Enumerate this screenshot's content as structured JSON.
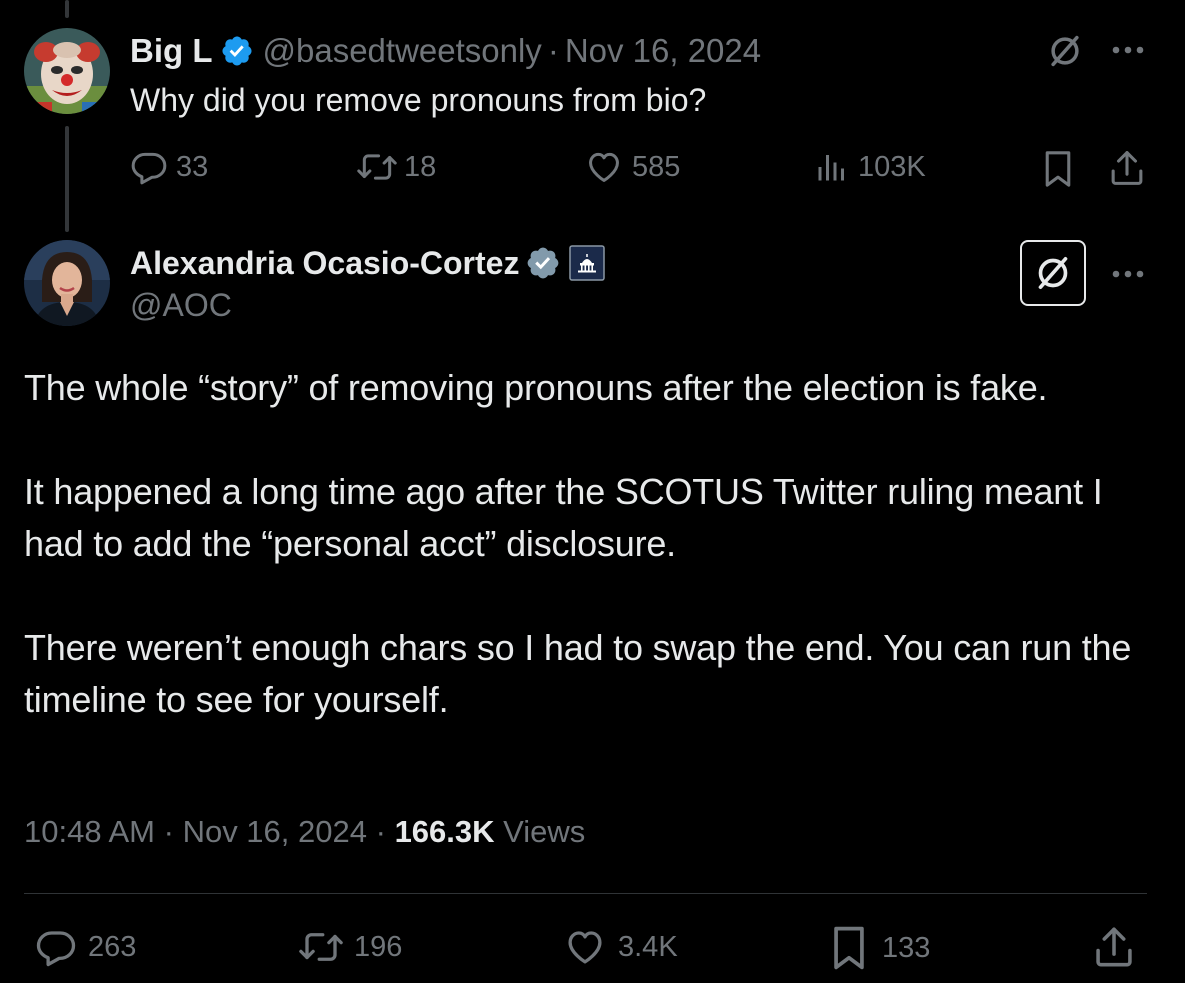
{
  "reply_tweet": {
    "display_name": "Big L",
    "handle": "@basedtweetsonly",
    "separator": "·",
    "date": "Nov 16, 2024",
    "text": "Why did you remove pronouns from bio?",
    "stats": {
      "replies": "33",
      "reposts": "18",
      "likes": "585",
      "views": "103K"
    }
  },
  "main_tweet": {
    "display_name": "Alexandria Ocasio-Cortez",
    "handle": "@AOC",
    "paragraphs": [
      "The whole “story” of removing pronouns after the election is fake.",
      "It happened a long time ago after the SCOTUS Twitter ruling meant I had to add the “personal acct” disclosure.",
      "There weren’t enough chars so I had to swap the end. You can run the timeline to see for yourself."
    ],
    "time": "10:48 AM",
    "separator": "·",
    "date": "Nov 16, 2024",
    "separator2": "·",
    "views_count": "166.3K",
    "views_label": "Views",
    "stats": {
      "replies": "263",
      "reposts": "196",
      "likes": "3.4K",
      "bookmarks": "133"
    }
  },
  "icons": {
    "verified": "verified-badge-icon",
    "affiliate": "capitol-badge-icon",
    "grok": "grok-icon",
    "more": "more-icon",
    "reply": "reply-icon",
    "repost": "repost-icon",
    "like": "like-icon",
    "views": "views-icon",
    "bookmark": "bookmark-icon",
    "share": "share-icon"
  },
  "colors": {
    "background": "#000000",
    "text": "#e7e9ea",
    "muted": "#71767b",
    "verified_blue": "#1d9bf0",
    "verified_gray": "#829aab"
  }
}
